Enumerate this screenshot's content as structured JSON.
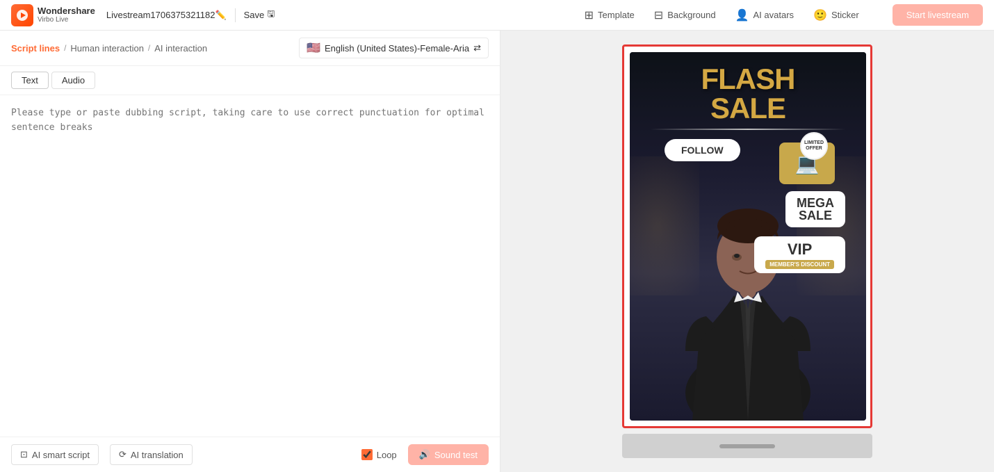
{
  "app": {
    "logo_line1": "Wondershare",
    "logo_line2": "Virbo Live",
    "title": "Livestream1706375321182",
    "save_label": "Save"
  },
  "topnav": {
    "template_label": "Template",
    "background_label": "Background",
    "ai_avatars_label": "AI avatars",
    "sticker_label": "Sticker",
    "start_btn": "Start livestream"
  },
  "script_panel": {
    "script_lines_label": "Script lines",
    "human_interaction_label": "Human interaction",
    "ai_interaction_label": "AI interaction",
    "lang_label": "English (United States)-Female-Aria",
    "tab_text": "Text",
    "tab_audio": "Audio",
    "textarea_placeholder": "Please type or paste dubbing script, taking care to use correct punctuation for optimal sentence breaks"
  },
  "bottom_bar": {
    "ai_smart_script_label": "AI smart script",
    "ai_translation_label": "AI translation",
    "loop_label": "Loop",
    "sound_test_label": "Sound test"
  },
  "preview": {
    "flash_label": "FLASH",
    "sale_label": "SALE",
    "follow_label": "FOLLOW",
    "mega_label": "MEGA",
    "sale2_label": "SALE",
    "vip_label": "VIP",
    "members_label": "MEMBER'S DISCOUNT",
    "badge_label": "LIMITED OFFER"
  }
}
